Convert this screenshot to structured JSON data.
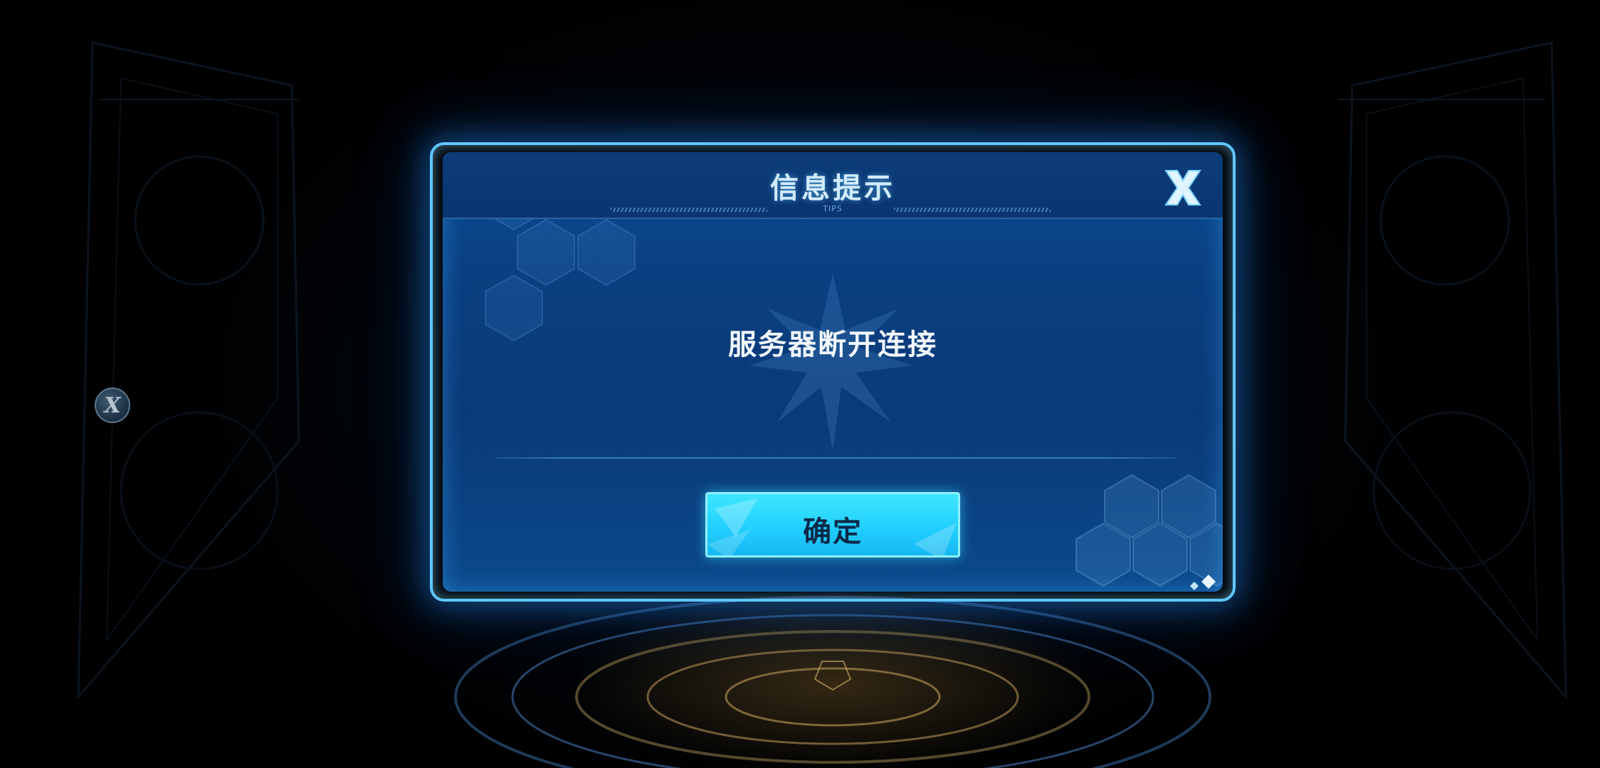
{
  "dialog": {
    "title": "信息提示",
    "subtitle": "TIPS",
    "message": "服务器断开连接",
    "confirm_label": "确定"
  },
  "side_badge": {
    "label": "X"
  },
  "icons": {
    "close": "close-x-icon"
  },
  "colors": {
    "frame": "#5fc8ff",
    "panel": "#0b3f80",
    "button": "#22cfff",
    "button_text": "#0b2a48"
  }
}
